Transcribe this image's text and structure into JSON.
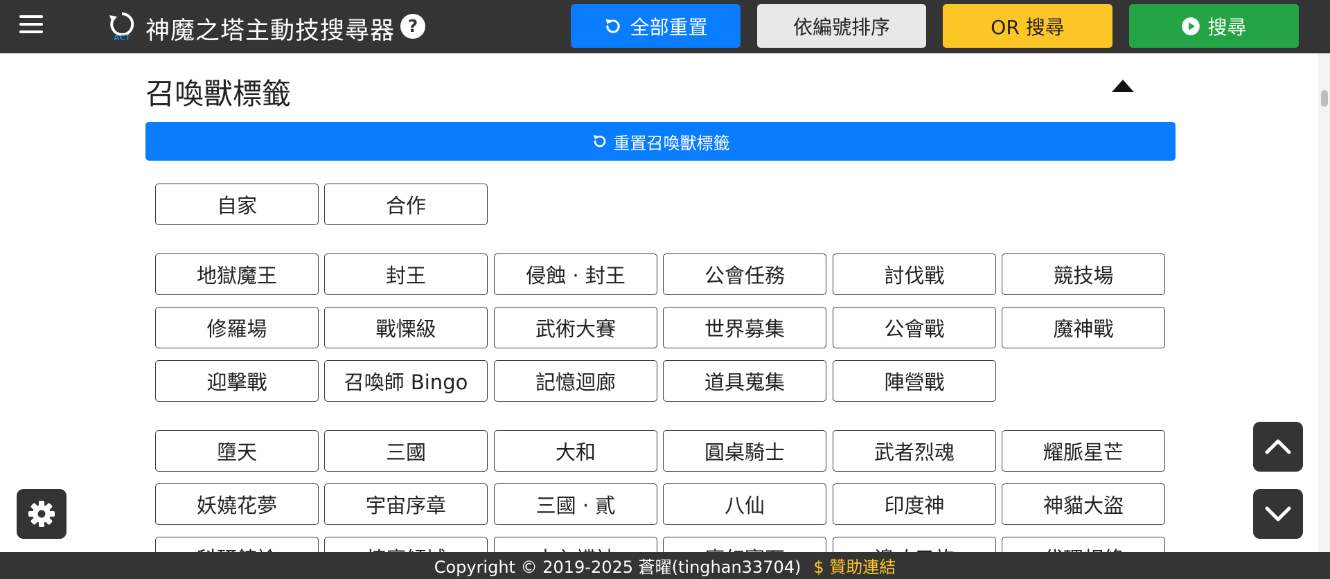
{
  "header": {
    "title": "神魔之塔主動技搜尋器",
    "logo_text": "ACT",
    "help_label": "?",
    "buttons": {
      "reset_all": "全部重置",
      "sort_by_id": "依編號排序",
      "or_search": "OR 搜尋",
      "search": "搜尋"
    }
  },
  "section": {
    "title": "召喚獸標籤",
    "reset_label": "重置召喚獸標籤"
  },
  "tag_groups": {
    "origin": [
      "自家",
      "合作"
    ],
    "events": [
      "地獄魔王",
      "封王",
      "侵蝕 · 封王",
      "公會任務",
      "討伐戰",
      "競技場",
      "修羅場",
      "戰慄級",
      "武術大賽",
      "世界募集",
      "公會戰",
      "魔神戰",
      "迎擊戰",
      "召喚師 Bingo",
      "記憶迴廊",
      "道具蒐集",
      "陣營戰"
    ],
    "series": [
      "墮天",
      "三國",
      "大和",
      "圓桌騎士",
      "武者烈魂",
      "耀脈星芒",
      "妖嬈花夢",
      "宇宙序章",
      "三國 · 貳",
      "八仙",
      "印度神",
      "神貓大盜",
      "科研鍊論",
      "煉魔傾城",
      "大內諜被",
      "魔幻寶石",
      "邊丈元旅",
      "代理相條"
    ]
  },
  "footer": {
    "copyright": "Copyright © 2019-2025 蒼曜(tinghan33704)",
    "sponsor_label": "贊助連結"
  },
  "colors": {
    "navbar_bg": "#343434",
    "primary_blue": "#0a7cff",
    "sort_gray": "#e8e8e8",
    "or_yellow": "#fdc627",
    "search_green": "#24a444",
    "footer_link": "#fdc627"
  },
  "icons": {
    "menu": "hamburger-icon",
    "reset": "rotate-ccw-icon",
    "search": "play-circle-icon",
    "collapse": "caret-up-icon",
    "settings": "gear-icon",
    "scroll_up": "chevron-up-icon",
    "scroll_down": "chevron-down-icon",
    "sponsor": "dollar-icon"
  }
}
